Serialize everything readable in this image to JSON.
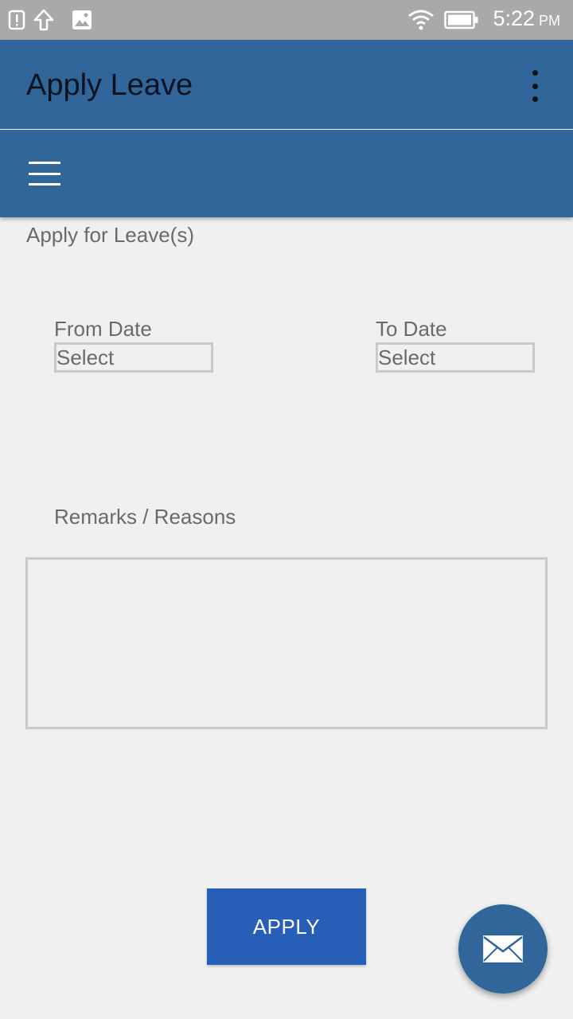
{
  "status_bar": {
    "time": "5:22",
    "ampm": "PM",
    "icons": [
      "alert-icon",
      "upload-icon",
      "image-icon",
      "wifi-icon",
      "battery-icon"
    ]
  },
  "app_bar": {
    "title": "Apply Leave",
    "menu_icon": "more-vert-icon"
  },
  "nav_bar": {
    "menu_icon": "hamburger-icon"
  },
  "form": {
    "section_title": "Apply for Leave(s)",
    "from_date": {
      "label": "From Date",
      "value": "Select"
    },
    "to_date": {
      "label": "To Date",
      "value": "Select"
    },
    "remarks": {
      "label": "Remarks / Reasons",
      "value": ""
    },
    "apply_label": "APPLY"
  },
  "fab": {
    "icon": "mail-icon"
  },
  "colors": {
    "primary": "#31669a",
    "button": "#265eb8",
    "status_bar": "#a9a9a9",
    "background": "#f0f0f0"
  }
}
